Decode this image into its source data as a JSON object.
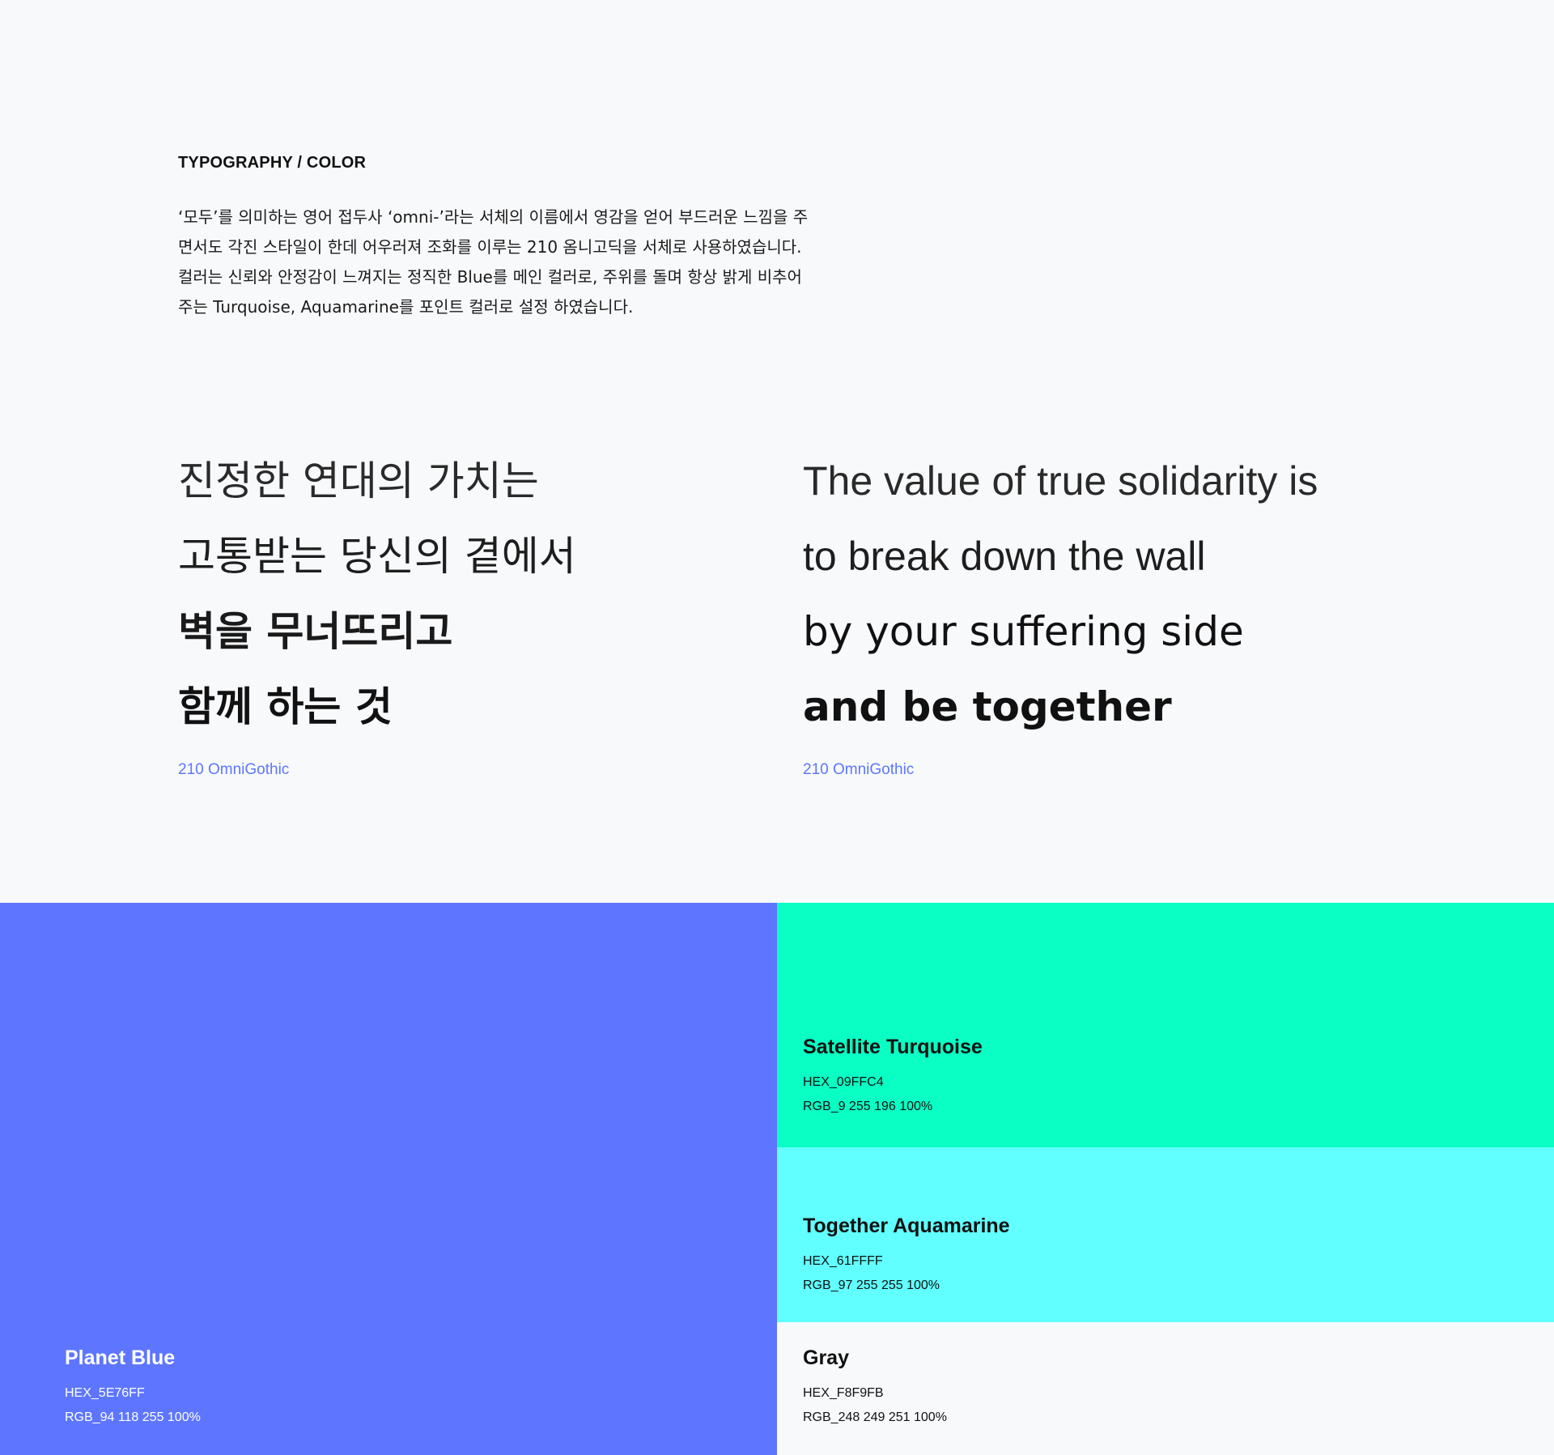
{
  "section": {
    "heading": "TYPOGRAPHY / COLOR"
  },
  "intro": {
    "lines": [
      "‘모두’를 의미하는 영어 접두사 ‘omni-’라는 서체의 이름에서 영감을 얻어 부드러운 느낌을 주",
      "면서도 각진 스타일이 한데 어우러져 조화를 이루는 210 옴니고딕을 서체로 사용하였습니다.",
      "컬러는 신뢰와 안정감이 느껴지는 정직한 Blue를 메인 컬러로, 주위를 돌며 항상 밝게 비추어",
      "주는 Turquoise, Aquamarine를 포인트 컬러로 설정 하였습니다."
    ]
  },
  "specimen_ko": {
    "lines": [
      "진정한 연대의 가치는",
      "고통받는 당신의 곁에서",
      "벽을 무너뜨리고",
      "함께 하는 것"
    ],
    "font_name": "210 OmniGothic"
  },
  "specimen_en": {
    "lines": [
      "The value of true solidarity is",
      "to break down the wall",
      "by your suffering side",
      "and be together"
    ],
    "font_name": "210 OmniGothic"
  },
  "colors": {
    "blue": {
      "name": "Planet Blue",
      "hex": "HEX_5E76FF",
      "rgb": "RGB_94 118 255 100%",
      "value": "#5E76FF"
    },
    "turquoise": {
      "name": "Satellite Turquoise",
      "hex": "HEX_09FFC4",
      "rgb": "RGB_9 255 196 100%",
      "value": "#09FFC4"
    },
    "aquamarine": {
      "name": "Together Aquamarine",
      "hex": "HEX_61FFFF",
      "rgb": "RGB_97 255 255 100%",
      "value": "#61FFFF"
    },
    "gray": {
      "name": "Gray",
      "hex": "HEX_F8F9FB",
      "rgb": "RGB_248 249 251 100%",
      "value": "#F8F9FB"
    }
  }
}
